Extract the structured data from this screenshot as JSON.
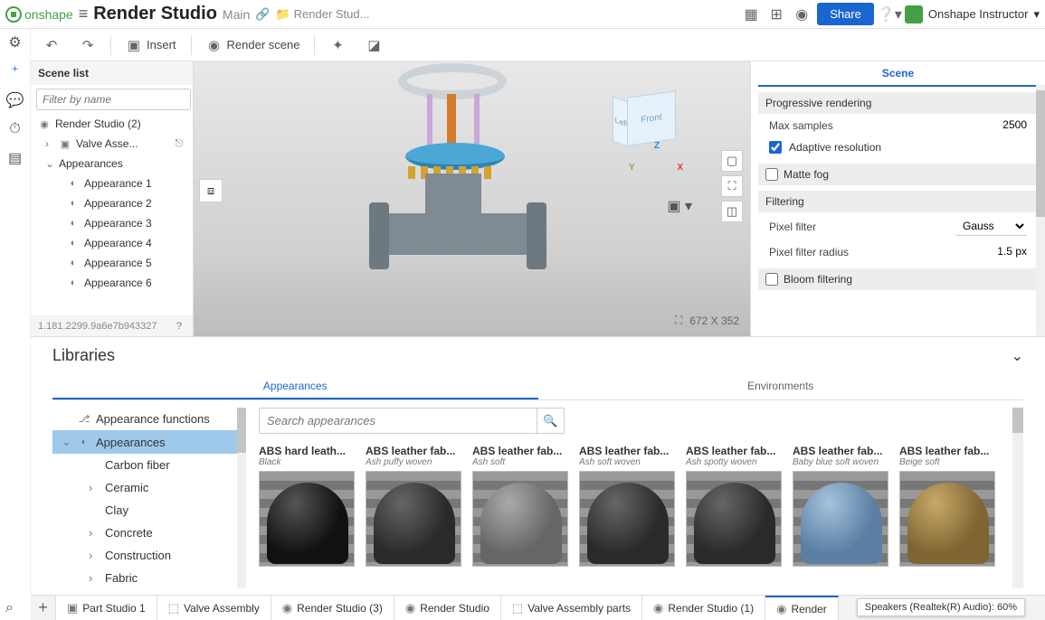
{
  "header": {
    "logo_text": "onshape",
    "doc_title": "Render Studio",
    "branch": "Main",
    "folder_crumb": "Render Stud...",
    "share_label": "Share",
    "user_name": "Onshape Instructor"
  },
  "toolbar": {
    "insert": "Insert",
    "render_scene": "Render scene"
  },
  "scene_panel": {
    "title": "Scene list",
    "filter_placeholder": "Filter by name",
    "root": "Render Studio (2)",
    "items": [
      {
        "label": "Valve Asse..."
      },
      {
        "label": "Appearances"
      }
    ],
    "appearances": [
      "Appearance 1",
      "Appearance 2",
      "Appearance 3",
      "Appearance 4",
      "Appearance 5",
      "Appearance 6"
    ],
    "footer_id": "1.181.2299.9a6e7b943327"
  },
  "viewport": {
    "cube_front": "Front",
    "cube_left": "Left",
    "axis_x": "X",
    "axis_y": "Y",
    "axis_z": "Z",
    "dim": "672 X 352"
  },
  "props": {
    "tab": "Scene",
    "sec_prog": "Progressive rendering",
    "max_samples_label": "Max samples",
    "max_samples_value": "2500",
    "adaptive_label": "Adaptive resolution",
    "matte_fog": "Matte fog",
    "sec_filter": "Filtering",
    "pixel_filter_label": "Pixel filter",
    "pixel_filter_value": "Gauss",
    "pixel_radius_label": "Pixel filter radius",
    "pixel_radius_value": "1.5 px",
    "bloom": "Bloom filtering"
  },
  "libraries": {
    "title": "Libraries",
    "tabs": {
      "appearances": "Appearances",
      "environments": "Environments"
    },
    "tree": [
      "Appearance functions",
      "Appearances",
      "Carbon fiber",
      "Ceramic",
      "Clay",
      "Concrete",
      "Construction",
      "Fabric"
    ],
    "search_placeholder": "Search appearances",
    "swatches": [
      {
        "name": "ABS hard leath...",
        "sub": "Black",
        "cls": "black"
      },
      {
        "name": "ABS leather fab...",
        "sub": "Ash puffy woven",
        "cls": "dark"
      },
      {
        "name": "ABS leather fab...",
        "sub": "Ash soft",
        "cls": "grey"
      },
      {
        "name": "ABS leather fab...",
        "sub": "Ash soft woven",
        "cls": "dark"
      },
      {
        "name": "ABS leather fab...",
        "sub": "Ash spotty woven",
        "cls": "dark"
      },
      {
        "name": "ABS leather fab...",
        "sub": "Baby blue soft woven",
        "cls": "blue"
      },
      {
        "name": "ABS leather fab...",
        "sub": "Beige soft",
        "cls": "beige"
      }
    ]
  },
  "bottom_tabs": [
    "Part Studio 1",
    "Valve Assembly",
    "Render Studio (3)",
    "Render Studio",
    "Valve Assembly parts",
    "Render Studio (1)",
    "Render"
  ],
  "tooltip": "Speakers (Realtek(R) Audio): 60%"
}
